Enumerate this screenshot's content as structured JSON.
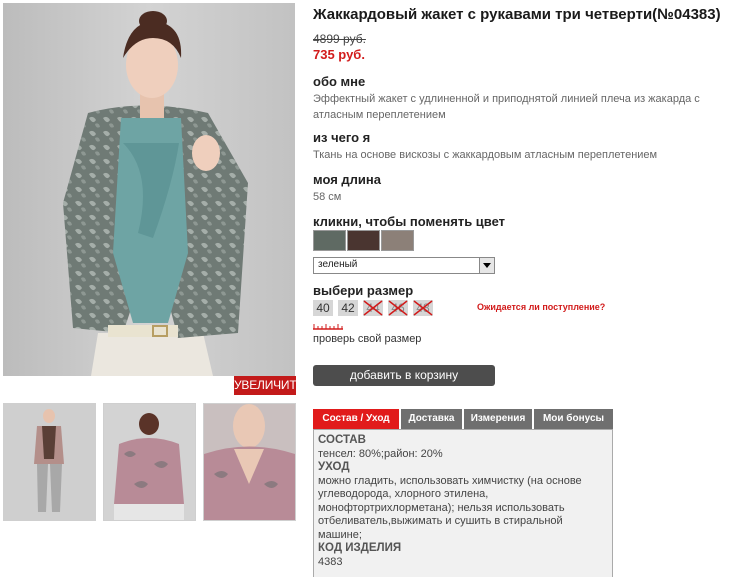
{
  "product": {
    "title": "Жаккардовый жакет с рукавами три четверти(№04383)",
    "old_price": "4899 руб.",
    "new_price": "735 руб."
  },
  "gallery": {
    "zoom_label": "УВЕЛИЧИТЬ",
    "thumbnails": [
      "thumb-full-outfit",
      "thumb-back-view",
      "thumb-collar-detail"
    ]
  },
  "about": {
    "heading": "обо мне",
    "text": "Эффектный жакет с удлиненной и приподнятой линией плеча из жакарда с атласным переплетением"
  },
  "material": {
    "heading": "из чего я",
    "text": "Ткань на основе вискозы с жаккардовым атласным переплетением"
  },
  "length": {
    "heading": "моя длина",
    "text": "58 см"
  },
  "color": {
    "heading": "кликни, чтобы поменять цвет",
    "swatches": [
      "#5f6a63",
      "#4a3530",
      "#8c8078"
    ],
    "selected": "зеленый"
  },
  "size": {
    "heading": "выбери размер",
    "available": [
      "40",
      "42"
    ],
    "unavailable": [
      "44",
      "46",
      "48"
    ],
    "notify_label": "Ожидается ли поступление?",
    "check_label": "проверь свой размер"
  },
  "cart": {
    "button_label": "добавить в корзину"
  },
  "tabs": {
    "items": [
      "Состав / Уход",
      "Доставка",
      "Измерения",
      "Мои бонусы"
    ],
    "active_index": 0
  },
  "details": {
    "composition_heading": "СОСТАВ",
    "composition_text": "тенсел: 80%;район: 20%",
    "care_heading": "УХОД",
    "care_text": "можно гладить, использовать химчистку (на основе углеводорода, хлорного этилена, монофтортрихлорметана); нельзя использовать отбеливатель,выжимать и сушить в стиральной машине;",
    "code_heading": "КОД ИЗДЕЛИЯ",
    "code_value": "4383"
  },
  "colors": {
    "accent_red": "#e11b1b",
    "price_red": "#d21b1b",
    "tab_gray": "#6f6f6f",
    "button_dark": "#4d4d4d"
  }
}
